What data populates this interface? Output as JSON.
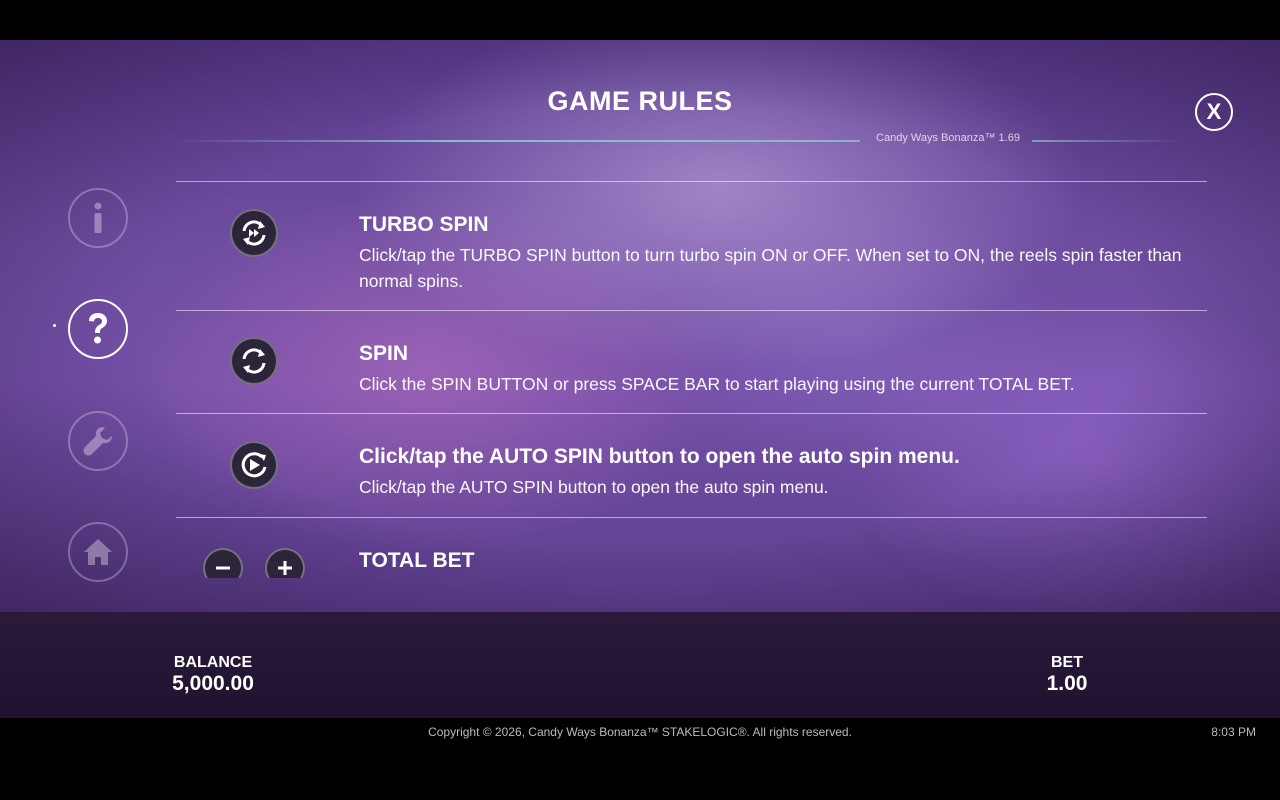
{
  "header": {
    "title": "GAME RULES",
    "version": "Candy Ways Bonanza™ 1.69",
    "close_label": "X"
  },
  "sidebar": {
    "items": [
      {
        "name": "info",
        "icon": "info-icon",
        "active": false
      },
      {
        "name": "help",
        "icon": "question-icon",
        "active": true
      },
      {
        "name": "settings",
        "icon": "wrench-icon",
        "active": false
      },
      {
        "name": "home",
        "icon": "home-icon",
        "active": false
      }
    ]
  },
  "rules": [
    {
      "icon": "turbo-spin-icon",
      "title": "TURBO SPIN",
      "text": "Click/tap the TURBO SPIN button to turn turbo spin ON or OFF. When set to ON, the reels spin faster than normal spins."
    },
    {
      "icon": "spin-icon",
      "title": "SPIN",
      "text": "Click the SPIN BUTTON or press SPACE BAR to start playing using the current TOTAL BET."
    },
    {
      "icon": "auto-spin-icon",
      "title": "Click/tap the AUTO SPIN button to open the auto spin menu.",
      "text": "Click/tap the AUTO SPIN button to open the auto spin menu."
    },
    {
      "icon": "bet-minus-plus-icons",
      "title": "TOTAL BET",
      "text": ""
    }
  ],
  "status": {
    "balance_label": "BALANCE",
    "balance_value": "5,000.00",
    "bet_label": "BET",
    "bet_value": "1.00"
  },
  "footer": {
    "copyright": "Copyright © 2026, Candy Ways Bonanza™ STAKELOGIC®. All rights reserved.",
    "time": "8:03 PM"
  },
  "colors": {
    "background_purple": "#6e4da0",
    "bar_dark": "#241634",
    "icon_dark": "#2c2438"
  }
}
